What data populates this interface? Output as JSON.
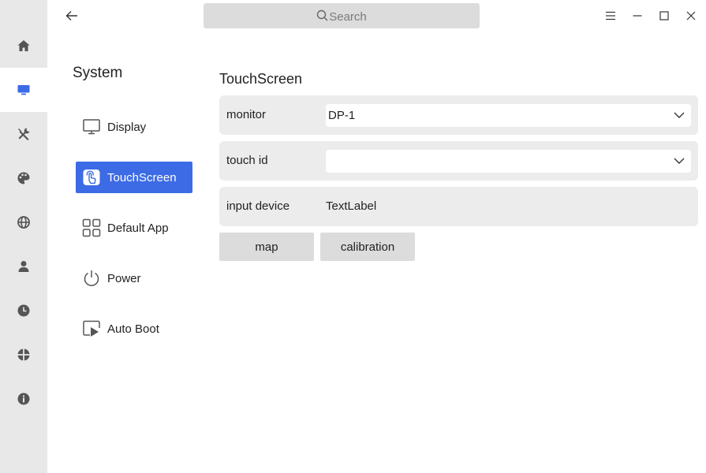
{
  "rail": {
    "items": [
      {
        "icon": "home-icon",
        "active": false
      },
      {
        "icon": "monitor-icon",
        "active": true
      },
      {
        "icon": "tools-icon",
        "active": false
      },
      {
        "icon": "palette-icon",
        "active": false
      },
      {
        "icon": "globe-icon",
        "active": false
      },
      {
        "icon": "user-icon",
        "active": false
      },
      {
        "icon": "clock-icon",
        "active": false
      },
      {
        "icon": "update-icon",
        "active": false
      },
      {
        "icon": "info-icon",
        "active": false
      }
    ],
    "active_color": "#3d6be5",
    "icon_color": "#555555"
  },
  "titlebar": {
    "search_placeholder": "Search"
  },
  "nav": {
    "title": "System",
    "items": [
      {
        "label": "Display",
        "icon": "monitor-icon"
      },
      {
        "label": "TouchScreen",
        "icon": "touchscreen-icon",
        "active": true
      },
      {
        "label": "Default App",
        "icon": "grid-icon"
      },
      {
        "label": "Power",
        "icon": "power-icon"
      },
      {
        "label": "Auto Boot",
        "icon": "autoboot-icon"
      }
    ]
  },
  "content": {
    "title": "TouchScreen",
    "monitor": {
      "label": "monitor",
      "value": "DP-1"
    },
    "touch_id": {
      "label": "touch id",
      "value": ""
    },
    "input_device": {
      "label": "input device",
      "value": "TextLabel"
    },
    "buttons": {
      "map": "map",
      "calibration": "calibration"
    }
  }
}
